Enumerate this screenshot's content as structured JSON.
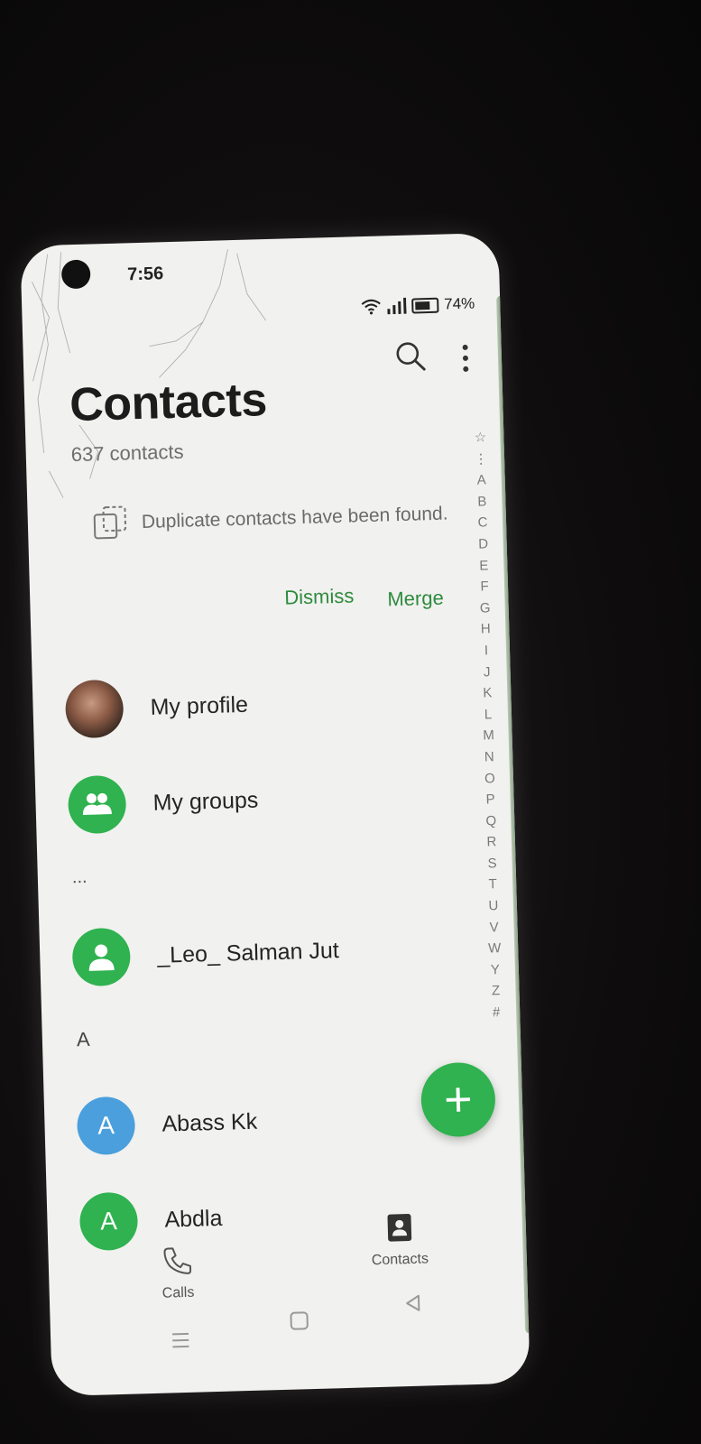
{
  "status_bar": {
    "time": "7:56",
    "battery": "74%",
    "wifi_icon": "wifi-icon",
    "signal_icon": "signal-icon"
  },
  "header": {
    "title": "Contacts",
    "count": "637 contacts",
    "search_icon": "search-icon",
    "more_icon": "more-vert-icon"
  },
  "duplicate_notice": {
    "icon": "duplicate-icon",
    "text": "Duplicate contacts have been found.",
    "dismiss_label": "Dismiss",
    "merge_label": "Merge"
  },
  "special_rows": {
    "profile_label": "My profile",
    "groups_label": "My groups"
  },
  "ellipsis_header": "...",
  "contacts_misc": [
    {
      "name": "_Leo_ Salman Jut"
    }
  ],
  "section_a": {
    "header": "A",
    "contacts": [
      {
        "initial": "A",
        "name": "Abass Kk",
        "color": "#4a9fdc"
      },
      {
        "initial": "A",
        "name": "Abdla",
        "color": "#2fb24f"
      }
    ]
  },
  "index_letters": [
    "☆",
    "⋮",
    "A",
    "B",
    "C",
    "D",
    "E",
    "F",
    "G",
    "H",
    "I",
    "J",
    "K",
    "L",
    "M",
    "N",
    "O",
    "P",
    "Q",
    "R",
    "S",
    "T",
    "U",
    "V",
    "W",
    "Y",
    "Z",
    "#"
  ],
  "fab": {
    "icon": "plus-icon"
  },
  "bottom_nav": {
    "calls_label": "Calls",
    "contacts_label": "Contacts"
  },
  "colors": {
    "accent_green": "#2fb24f",
    "link_green": "#2e8b3e",
    "avatar_blue": "#4a9fdc"
  }
}
